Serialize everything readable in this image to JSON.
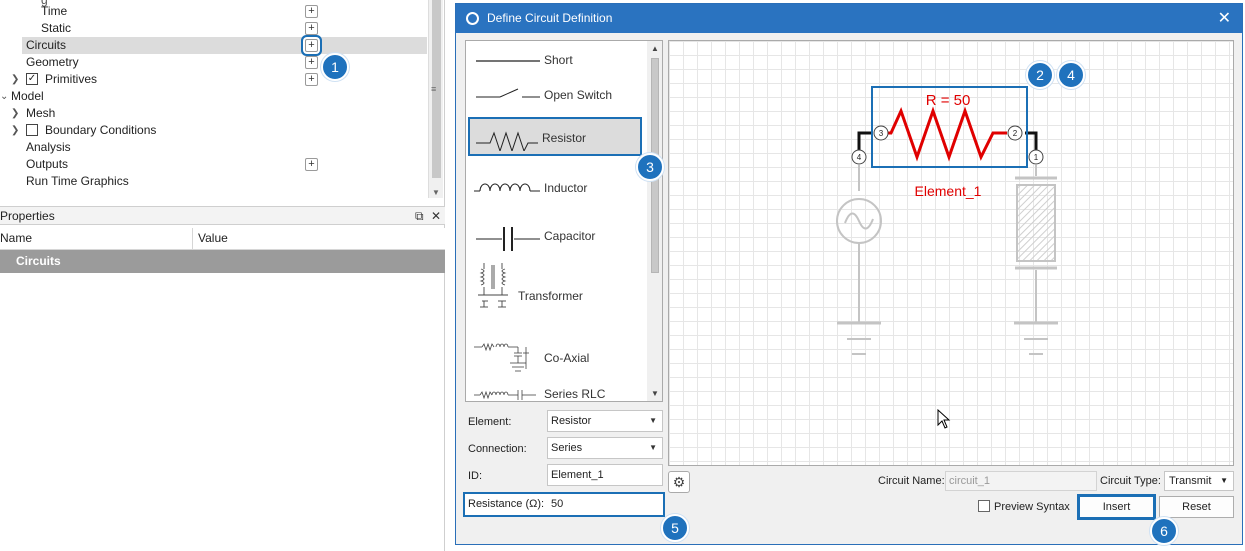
{
  "tree": {
    "items": [
      {
        "label": "Time"
      },
      {
        "label": "Static"
      },
      {
        "label": "Circuits"
      },
      {
        "label": "Geometry"
      },
      {
        "label": "Primitives"
      },
      {
        "label": "Model"
      },
      {
        "label": "Mesh"
      },
      {
        "label": "Boundary Conditions"
      },
      {
        "label": "Analysis"
      },
      {
        "label": "Outputs"
      },
      {
        "label": "Run Time Graphics"
      }
    ],
    "add_label": "+"
  },
  "properties": {
    "title": "Properties",
    "col_name": "Name",
    "col_value": "Value",
    "category": "Circuits"
  },
  "dialog": {
    "title": "Define Circuit Definition",
    "palette": [
      {
        "label": "Short"
      },
      {
        "label": "Open Switch"
      },
      {
        "label": "Resistor"
      },
      {
        "label": "Inductor"
      },
      {
        "label": "Capacitor"
      },
      {
        "label": "Transformer"
      },
      {
        "label": "Co-Axial"
      },
      {
        "label": "Series RLC"
      }
    ],
    "form": {
      "element_label": "Element:",
      "element_value": "Resistor",
      "connection_label": "Connection:",
      "connection_value": "Series",
      "id_label": "ID:",
      "id_value": "Element_1",
      "resistance_label": "Resistance (Ω):",
      "resistance_value": "50"
    },
    "diagram": {
      "resistor_value": "R = 50",
      "element_name": "Element_1",
      "pins": [
        "3",
        "2",
        "4",
        "1"
      ]
    },
    "circuit_name_label": "Circuit Name:",
    "circuit_name_placeholder": "circuit_1",
    "circuit_type_label": "Circuit Type:",
    "circuit_type_value": "Transmit",
    "preview_label": "Preview Syntax",
    "insert_label": "Insert",
    "reset_label": "Reset"
  },
  "badges": [
    "1",
    "2",
    "3",
    "4",
    "5",
    "6"
  ],
  "colors": {
    "accent": "#1f72bd",
    "resistor": "#e00000"
  }
}
